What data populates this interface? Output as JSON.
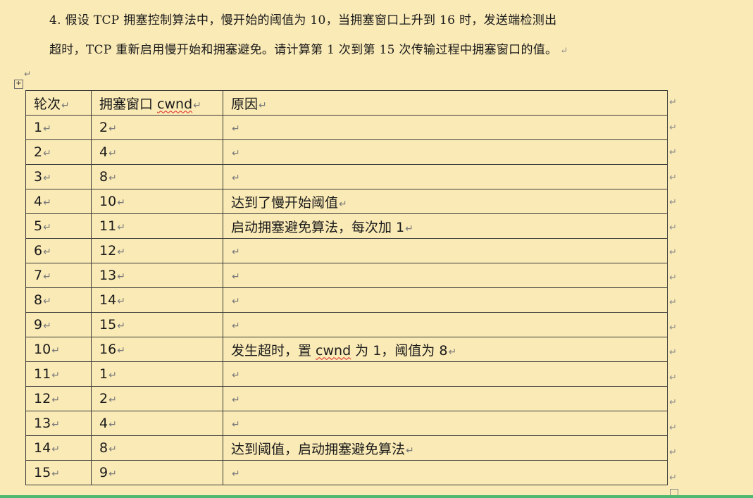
{
  "question": {
    "line1": "4. 假设 TCP 拥塞控制算法中，慢开始的阈值为 10，当拥塞窗口上升到 16 时，发送端检测出",
    "line2": "超时，TCP 重新启用慢开始和拥塞避免。请计算第 1 次到第 15 次传输过程中拥塞窗口的值。"
  },
  "marks": {
    "para": "↵",
    "move": "+"
  },
  "table": {
    "headers": [
      "轮次",
      "拥塞窗口 cwnd",
      "原因"
    ],
    "rows": [
      {
        "round": "1",
        "cwnd": "2",
        "reason": ""
      },
      {
        "round": "2",
        "cwnd": "4",
        "reason": ""
      },
      {
        "round": "3",
        "cwnd": "8",
        "reason": ""
      },
      {
        "round": "4",
        "cwnd": "10",
        "reason": "达到了慢开始阈值"
      },
      {
        "round": "5",
        "cwnd": "11",
        "reason": "启动拥塞避免算法，每次加 1"
      },
      {
        "round": "6",
        "cwnd": "12",
        "reason": ""
      },
      {
        "round": "7",
        "cwnd": "13",
        "reason": ""
      },
      {
        "round": "8",
        "cwnd": "14",
        "reason": ""
      },
      {
        "round": "9",
        "cwnd": "15",
        "reason": ""
      },
      {
        "round": "10",
        "cwnd": "16",
        "reason": "发生超时，置 cwnd 为 1，阈值为 8"
      },
      {
        "round": "11",
        "cwnd": "1",
        "reason": ""
      },
      {
        "round": "12",
        "cwnd": "2",
        "reason": ""
      },
      {
        "round": "13",
        "cwnd": "4",
        "reason": ""
      },
      {
        "round": "14",
        "cwnd": "8",
        "reason": "达到阈值，启动拥塞避免算法"
      },
      {
        "round": "15",
        "cwnd": "9",
        "reason": ""
      }
    ]
  },
  "colors": {
    "page_background": "#faeab6",
    "spellcheck_underline": "#d22222",
    "status_bar": "#4fb86e"
  }
}
